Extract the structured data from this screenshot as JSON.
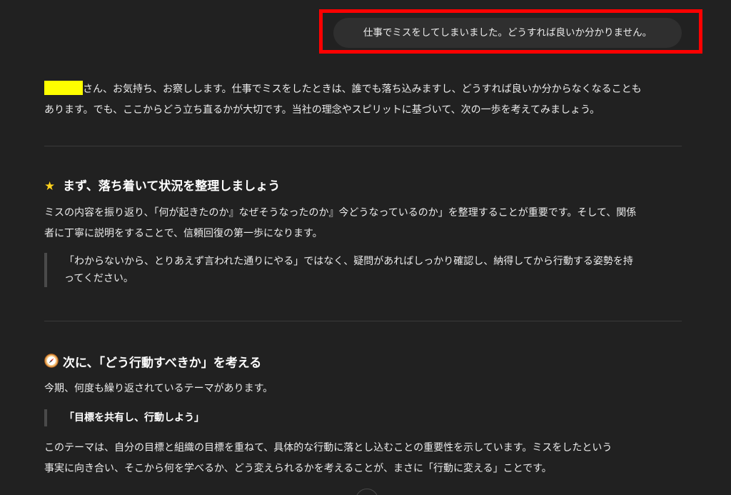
{
  "user_message": "仕事でミスをしてしまいました。どうすれば良いか分かりません。",
  "intro": {
    "line1_after_name": "さん、お気持ち、お察しします。仕事でミスをしたときは、誰でも落ち込みますし、どうすれば良いか分からなくなることも",
    "line2": "あります。でも、ここからどう立ち直るかが大切です。当社の理念やスピリットに基づいて、次の一歩を考えてみましょう。"
  },
  "section1": {
    "icon": "star-icon",
    "heading": "まず、落ち着いて状況を整理しましょう",
    "body_line1": "ミスの内容を振り返り、「何が起きたのか』なぜそうなったのか』今どうなっているのか」を整理することが重要です。そして、関係",
    "body_line2": "者に丁寧に説明をすることで、信頼回復の第一歩になります。",
    "quote_line1": "「わからないから、とりあえず言われた通りにやる」ではなく、疑問があればしっかり確認し、納得してから行動する姿勢を持",
    "quote_line2": "ってください。"
  },
  "section2": {
    "icon": "compass-icon",
    "heading": "次に、「どう行動すべきか」を考える",
    "body": "今期、何度も繰り返されているテーマがあります。",
    "quote": "「目標を共有し、行動しよう」",
    "closing_line1": "このテーマは、自分の目標と組織の目標を重ねて、具体的な行動に落とし込むことの重要性を示しています。ミスをしたという",
    "closing_line2": "事実に向き合い、そこから何を学べるか、どう変えられるかを考えることが、まさに「行動に変える」ことです。"
  },
  "colors": {
    "background": "#212121",
    "bubble": "#2f2f2f",
    "highlight_box": "#ff0000",
    "redaction": "#ffff00",
    "star": "#ffd21f"
  }
}
